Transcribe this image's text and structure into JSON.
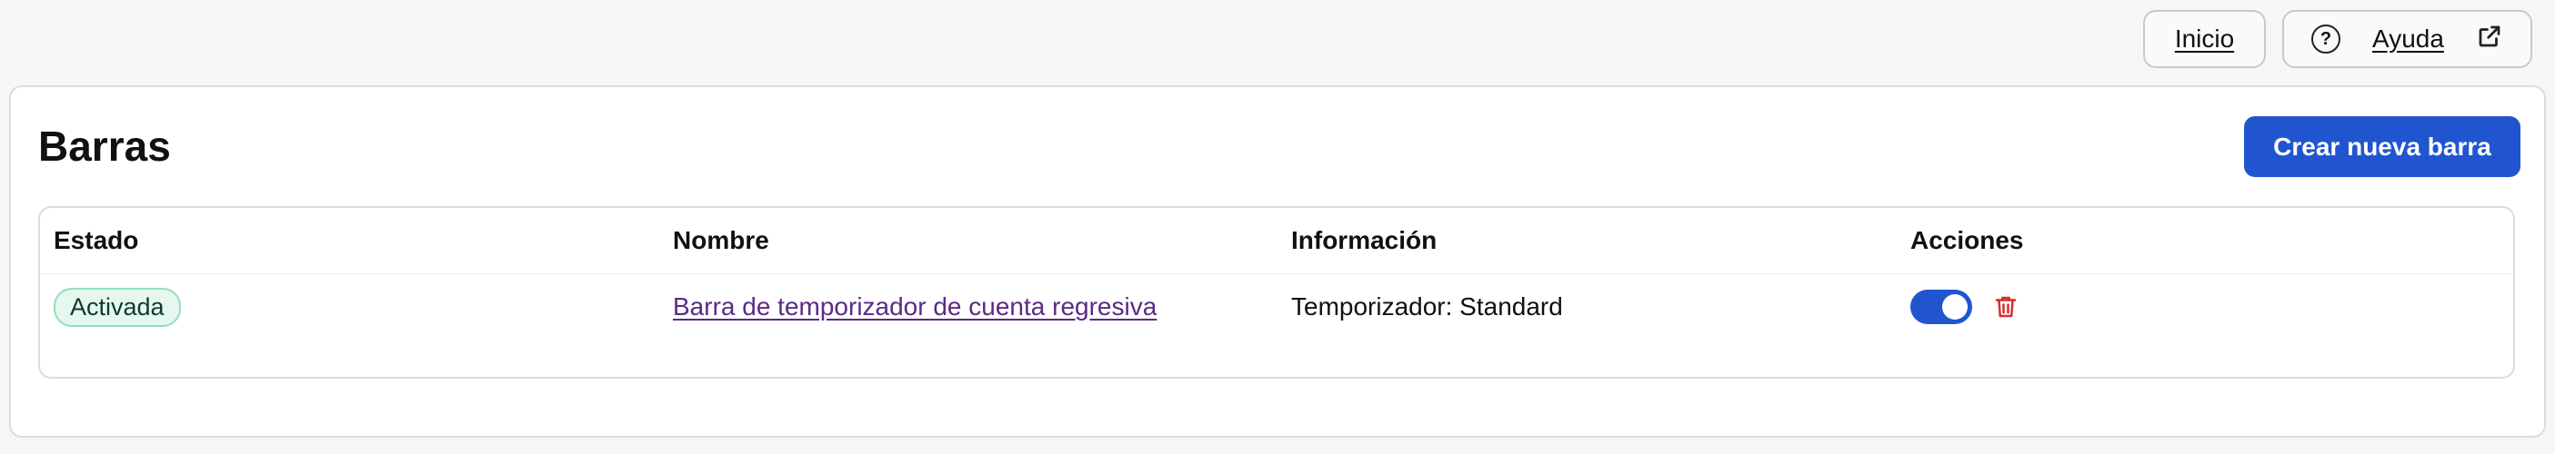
{
  "topbar": {
    "home_label": "Inicio",
    "help_label": "Ayuda",
    "help_icon": "question-circle-icon",
    "external_icon": "external-link-icon"
  },
  "page": {
    "title": "Barras",
    "create_button": "Crear nueva barra"
  },
  "table": {
    "headers": [
      "Estado",
      "Nombre",
      "Información",
      "Acciones"
    ],
    "rows": [
      {
        "status": "Activada",
        "name": "Barra de temporizador de cuenta regresiva",
        "info": "Temporizador: Standard",
        "enabled": true
      }
    ]
  },
  "colors": {
    "primary": "#2155d0",
    "badge_bg": "#e6f7ef",
    "badge_border": "#8fe0b8",
    "link": "#5b2a86",
    "danger": "#d32f2f"
  }
}
